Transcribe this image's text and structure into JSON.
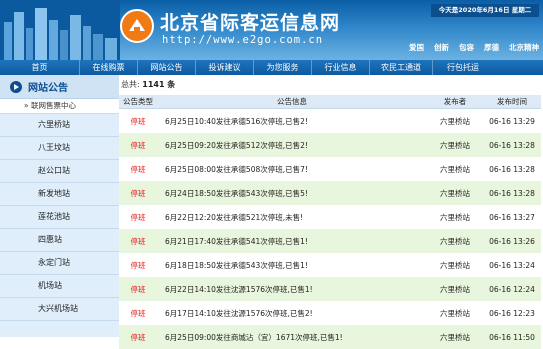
{
  "header": {
    "site_title": "北京省际客运信息网",
    "site_url": "http://www.e2go.com.cn",
    "date_text": "今天是2020年6月16日 星期二",
    "slogans": [
      "爱国",
      "创新",
      "包容",
      "厚德",
      "北京精神"
    ]
  },
  "nav": [
    "首页",
    "在线购票",
    "网站公告",
    "投诉建议",
    "为您服务",
    "行业信息",
    "农民工通道",
    "行包托运"
  ],
  "sidebar": {
    "title": "网站公告",
    "sub": "» 联网售票中心",
    "items": [
      "六里桥站",
      "八王坟站",
      "赵公口站",
      "新发地站",
      "莲花池站",
      "四惠站",
      "永定门站",
      "机场站",
      "大兴机场站"
    ]
  },
  "main": {
    "total_label": "总共:",
    "total_count": "1141 条",
    "columns": [
      "公告类型",
      "公告信息",
      "发布者",
      "发布时间"
    ],
    "rows": [
      {
        "type": "停班",
        "info": "6月25日10:40发往承德516次停班,已售2!",
        "publisher": "六里桥站",
        "time": "06-16 13:29"
      },
      {
        "type": "停班",
        "info": "6月25日09:20发往承德512次停班,已售2!",
        "publisher": "六里桥站",
        "time": "06-16 13:28"
      },
      {
        "type": "停班",
        "info": "6月25日08:00发往承德508次停班,已售7!",
        "publisher": "六里桥站",
        "time": "06-16 13:28"
      },
      {
        "type": "停班",
        "info": "6月24日18:50发往承德543次停班,已售5!",
        "publisher": "六里桥站",
        "time": "06-16 13:28"
      },
      {
        "type": "停班",
        "info": "6月22日12:20发往承德521次停班,未售!",
        "publisher": "六里桥站",
        "time": "06-16 13:27"
      },
      {
        "type": "停班",
        "info": "6月21日17:40发往承德541次停班,已售1!",
        "publisher": "六里桥站",
        "time": "06-16 13:26"
      },
      {
        "type": "停班",
        "info": "6月18日18:50发往承德543次停班,已售1!",
        "publisher": "六里桥站",
        "time": "06-16 13:24"
      },
      {
        "type": "停班",
        "info": "6月22日14:10发往沈源1576次停班,已售1!",
        "publisher": "六里桥站",
        "time": "06-16 12:24"
      },
      {
        "type": "停班",
        "info": "6月17日14:10发往沈源1576次停班,已售2!",
        "publisher": "六里桥站",
        "time": "06-16 12:23"
      },
      {
        "type": "停班",
        "info": "6月25日09:00发往商城沾（宜）1671次停班,已售1!",
        "publisher": "六里桥站",
        "time": "06-16 11:50"
      }
    ]
  }
}
